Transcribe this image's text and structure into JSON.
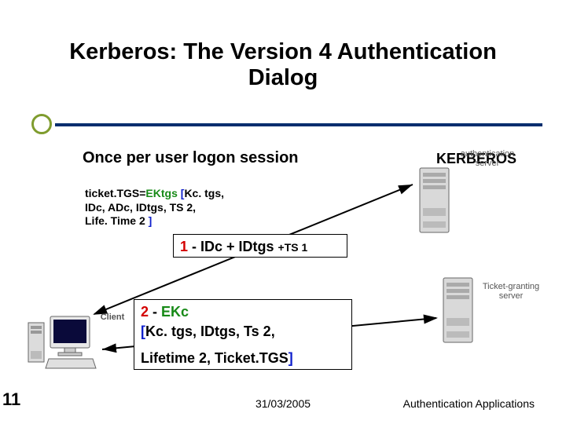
{
  "title": "Kerberos: The Version 4 Authentication Dialog",
  "subtitle": "Once per user logon session",
  "kerberosLabel": "KERBEROS",
  "ticketText": {
    "prefix": "ticket.TGS=",
    "ektgs": "EKtgs ",
    "open": "[",
    "body1": "Kc. tgs,",
    "body2": "IDc, ADc, IDtgs, TS 2,",
    "body3": "Life. Time 2 ",
    "close": "]"
  },
  "messages": {
    "m1": {
      "num": "1 ",
      "dash": "- ",
      "body": "IDc + IDtgs ",
      "ts": "+TS 1"
    },
    "m2": {
      "num": "2 ",
      "dash": "- ",
      "ekc": "EKc",
      "open": "[",
      "line2": "Kc. tgs, IDtgs, Ts 2,",
      "line3a": "Lifetime 2, Ticket.TGS",
      "close": "]"
    }
  },
  "labels": {
    "authServer": "authentication server",
    "tgs": "Ticket-granting server",
    "client": "Client"
  },
  "footer": {
    "date": "31/03/2005",
    "right": "Authentication Applications"
  },
  "slideNumber": "11"
}
